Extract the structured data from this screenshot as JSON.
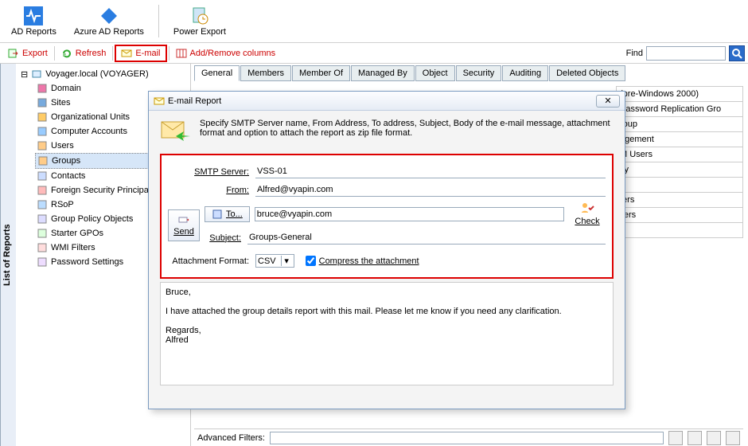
{
  "ribbon": {
    "adreports": "AD Reports",
    "azure": "Azure AD Reports",
    "power": "Power Export"
  },
  "toolbar": {
    "export": "Export",
    "refresh": "Refresh",
    "email": "E-mail",
    "cols": "Add/Remove columns",
    "find": "Find"
  },
  "tree": {
    "root": "Voyager.local (VOYAGER)",
    "items": [
      "Domain",
      "Sites",
      "Organizational Units",
      "Computer Accounts",
      "Users",
      "Groups",
      "Contacts",
      "Foreign Security Principals",
      "RSoP",
      "Group Policy Objects",
      "Starter GPOs",
      "WMI Filters",
      "Password Settings"
    ]
  },
  "tabs": [
    "General",
    "Members",
    "Member Of",
    "Managed By",
    "Object",
    "Security",
    "Auditing",
    "Deleted Objects"
  ],
  "sidelabel": "List of Reports",
  "bg_rows": [
    "(pre-Windows 2000)",
    "Password Replication Gro",
    "roup",
    "agement",
    "M Users",
    "xy",
    "s",
    "ters",
    "llers",
    "s"
  ],
  "dialog": {
    "title": "E-mail Report",
    "desc": "Specify SMTP Server name, From Address, To address, Subject, Body of the e-mail message, attachment format and option to attach the report as zip file format.",
    "labels": {
      "smtp": "SMTP Server:",
      "from": "From:",
      "to": "To...",
      "subject": "Subject:",
      "attach": "Attachment Format:",
      "compress": "Compress the attachment",
      "send": "Send",
      "check": "Check"
    },
    "values": {
      "smtp": "VSS-01",
      "from": "Alfred@vyapin.com",
      "to": "bruce@vyapin.com",
      "subject": "Groups-General",
      "format": "CSV",
      "compress": true
    },
    "body": "Bruce,\n\nI have attached the group details report with this mail. Please let me know if you need any clarification.\n\nRegards,\nAlfred"
  },
  "footer": {
    "label": "Advanced Filters:"
  }
}
